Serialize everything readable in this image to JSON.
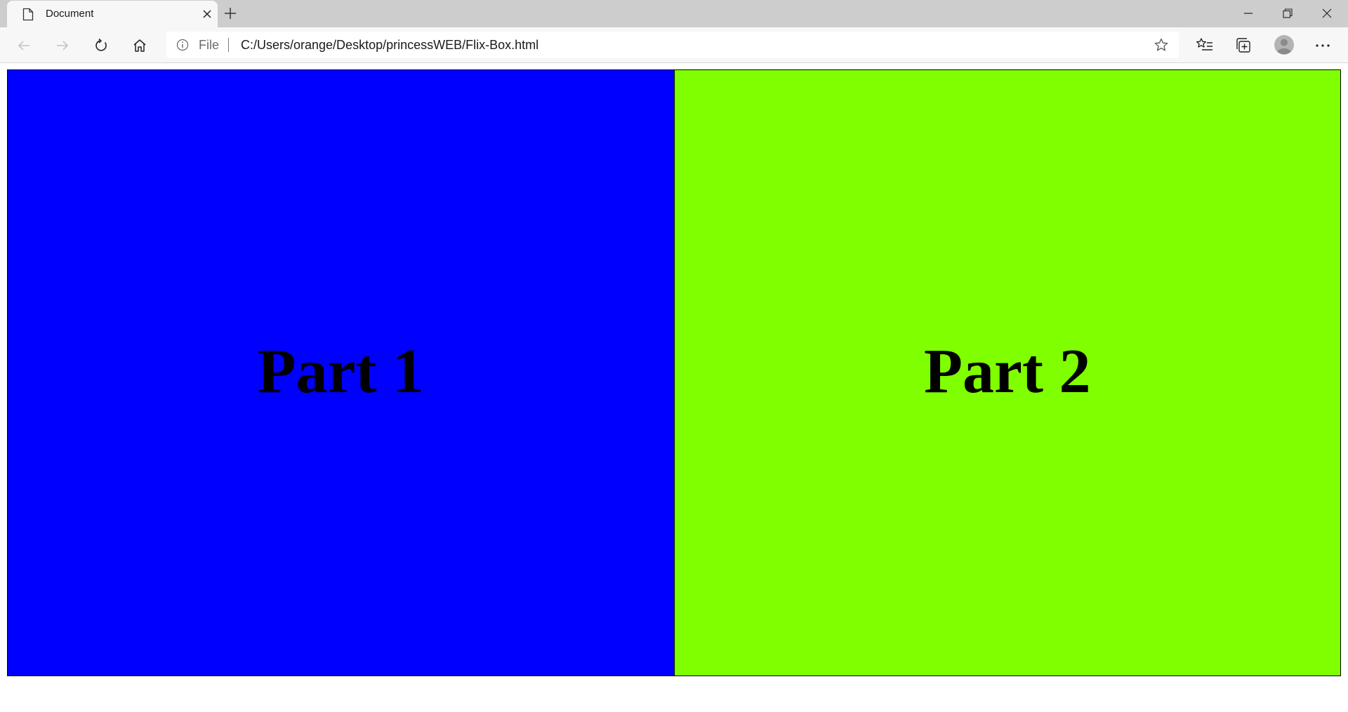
{
  "browser": {
    "tab": {
      "title": "Document",
      "icon": "document-icon"
    },
    "window_controls": [
      "minimize-icon",
      "restore-icon",
      "close-icon"
    ],
    "address_bar": {
      "scheme_label": "File",
      "url": "C:/Users/orange/Desktop/princessWEB/Flix-Box.html",
      "info_icon": "info-icon",
      "favorite_icon": "star-icon"
    },
    "toolbar_icons": [
      "back-arrow-icon",
      "forward-arrow-icon",
      "refresh-icon",
      "home-icon",
      "favorites-icon",
      "collections-icon",
      "profile-avatar-icon",
      "more-icon"
    ]
  },
  "page": {
    "parts": [
      {
        "label": "Part 1",
        "color": "#0000ff"
      },
      {
        "label": "Part 2",
        "color": "#80ff00"
      }
    ],
    "border_color": "#000000"
  }
}
